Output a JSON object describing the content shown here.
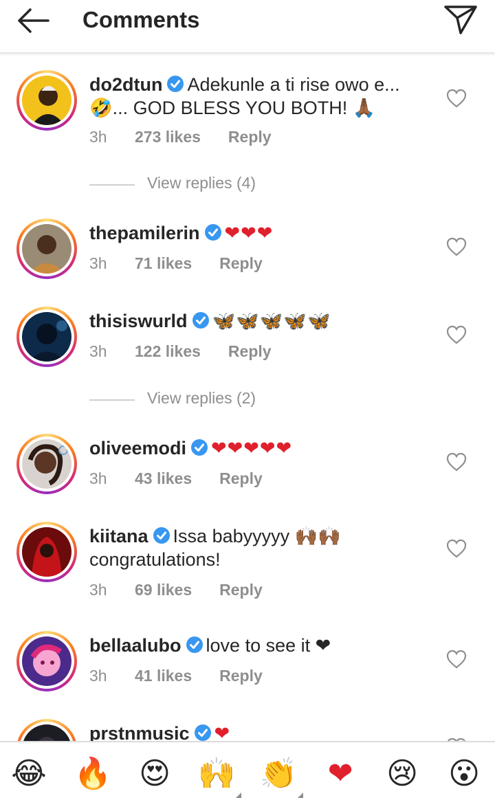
{
  "header": {
    "title": "Comments",
    "back_icon": "arrow-left-icon",
    "send_icon": "paper-plane-icon"
  },
  "comments": [
    {
      "username": "do2dtun",
      "text_line1": "Adekunle a ti rise owo e...",
      "text_line2": "🤣... GOD BLESS YOU BOTH! 🙏🏾",
      "time": "3h",
      "likes": "273 likes",
      "reply": "Reply",
      "view_replies": "View replies (4)"
    },
    {
      "username": "thepamilerin",
      "text_line1": "❤❤❤",
      "time": "3h",
      "likes": "71 likes",
      "reply": "Reply"
    },
    {
      "username": "thisiswurld",
      "text_line1": "🦋🦋🦋🦋🦋",
      "time": "3h",
      "likes": "122 likes",
      "reply": "Reply",
      "view_replies": "View replies (2)"
    },
    {
      "username": "oliveemodi",
      "text_line1": "❤❤❤❤❤",
      "time": "3h",
      "likes": "43 likes",
      "reply": "Reply"
    },
    {
      "username": "kiitana",
      "text_line1": "Issa babyyyyy 🙌🏾🙌🏾",
      "text_line2": "congratulations!",
      "time": "3h",
      "likes": "69 likes",
      "reply": "Reply"
    },
    {
      "username": "bellaalubo",
      "text_line1": "love to see it ❤",
      "time": "3h",
      "likes": "41 likes",
      "reply": "Reply"
    },
    {
      "username": "prstnmusic",
      "text_line1": "❤"
    }
  ],
  "emoji_bar": [
    "😂",
    "🔥",
    "😍",
    "🙌",
    "👏",
    "❤",
    "😢",
    "😮"
  ],
  "colors": {
    "verified_blue": "#3897f0",
    "heart_red": "#e0202c",
    "meta_gray": "#8e8e8e",
    "text": "#262626"
  }
}
